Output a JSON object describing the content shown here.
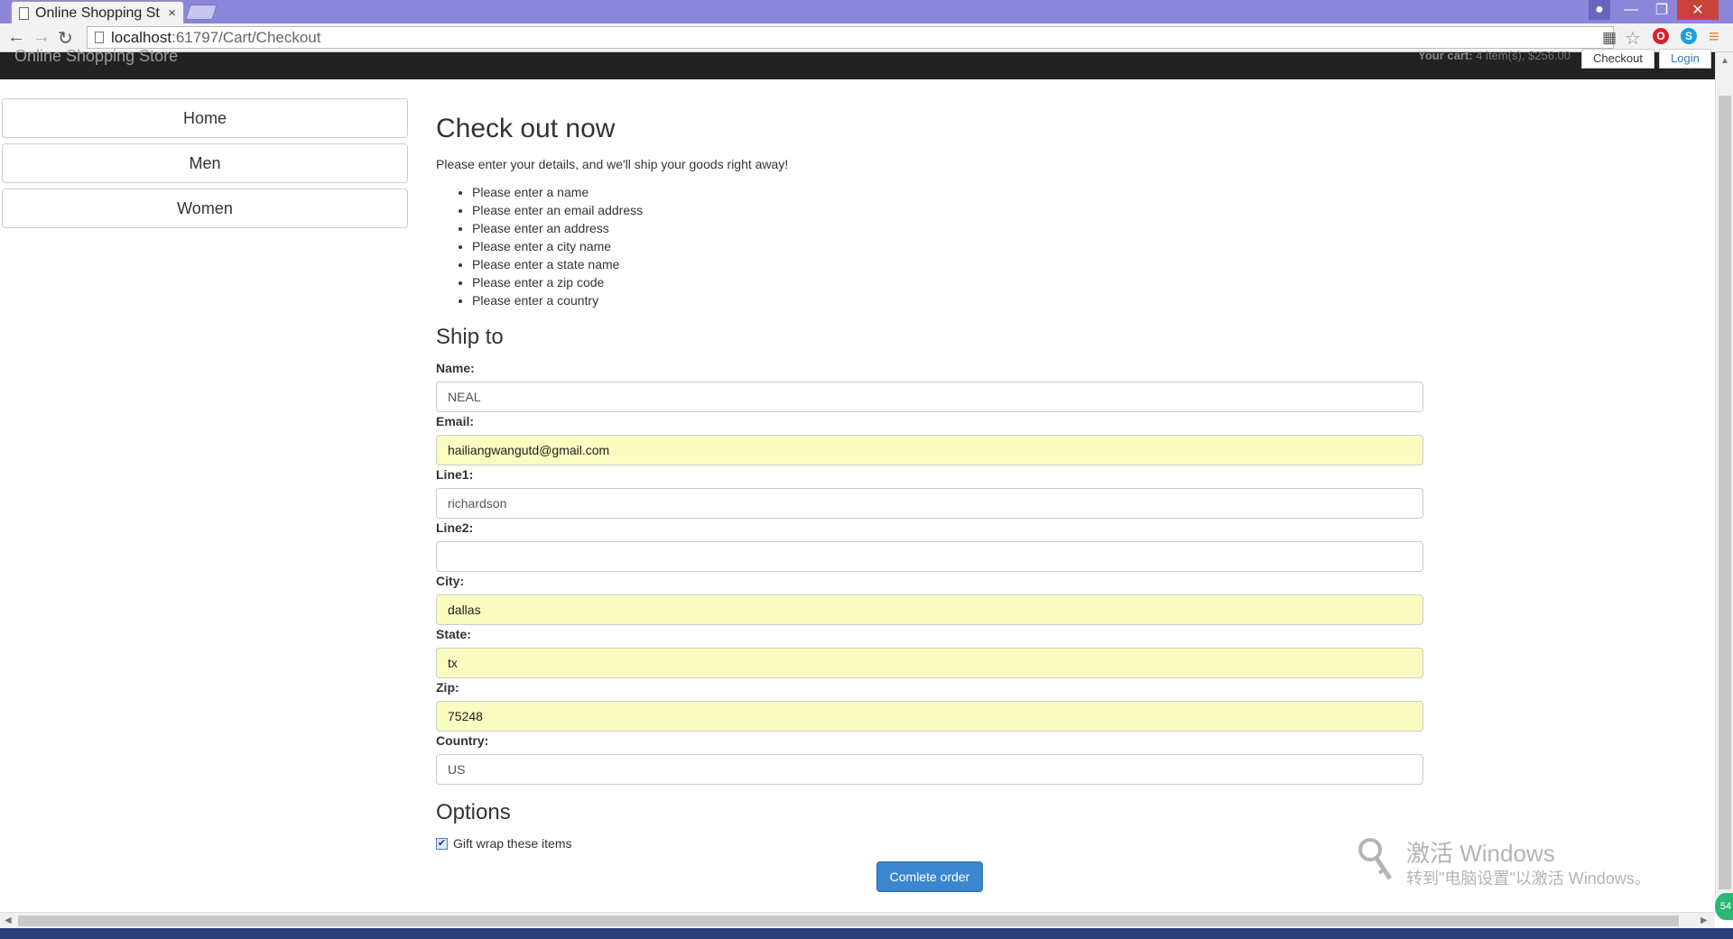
{
  "browser": {
    "tab_title": "Online Shopping St",
    "tab_close": "×",
    "url_host": "localhost",
    "url_path": ":61797/Cart/Checkout"
  },
  "site": {
    "brand": "Online Shopping Store",
    "cart_label": "Your cart:",
    "cart_summary": "4 item(s), $256.00",
    "checkout_label": "Checkout",
    "login_label": "Login"
  },
  "sidebar": {
    "items": [
      {
        "label": "Home"
      },
      {
        "label": "Men"
      },
      {
        "label": "Women"
      }
    ]
  },
  "main": {
    "title": "Check out now",
    "intro": "Please enter your details, and we'll ship your goods right away!",
    "errors": [
      "Please enter a name",
      "Please enter an email address",
      "Please enter an address",
      "Please enter a city name",
      "Please enter a state name",
      "Please enter a zip code",
      "Please enter a country"
    ],
    "ship_heading": "Ship to",
    "fields": [
      {
        "label": "Name:",
        "value": "NEAL"
      },
      {
        "label": "Email:",
        "value": "hailiangwangutd@gmail.com"
      },
      {
        "label": "Line1:",
        "value": "richardson"
      },
      {
        "label": "Line2:",
        "value": ""
      },
      {
        "label": "City:",
        "value": "dallas"
      },
      {
        "label": "State:",
        "value": "tx"
      },
      {
        "label": "Zip:",
        "value": "75248"
      },
      {
        "label": "Country:",
        "value": "US"
      }
    ],
    "options_heading": "Options",
    "giftwrap_label": "Gift wrap these items",
    "giftwrap_checked": true,
    "submit_label": "Comlete order"
  },
  "watermark": {
    "line1": "激活 Windows",
    "line2": "转到\"电脑设置\"以激活 Windows。"
  },
  "colors": {
    "titlebar": "#8c86db",
    "autofill": "#fafcc0",
    "primary": "#3a87cf",
    "navbar": "#222222"
  }
}
